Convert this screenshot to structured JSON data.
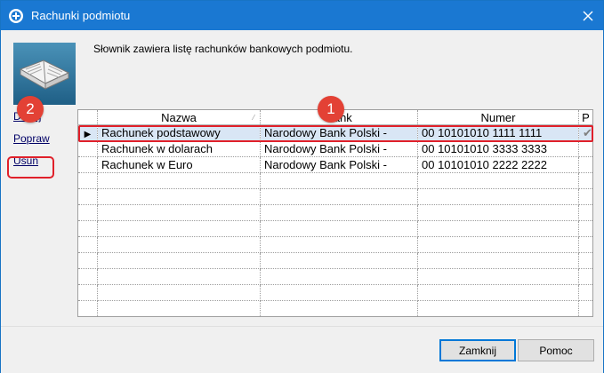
{
  "window": {
    "title": "Rachunki podmiotu",
    "title_bar_color": "#1a78d2"
  },
  "description": "Słownik zawiera listę rachunków bankowych podmiotu.",
  "side_actions": {
    "dodaj": "Dodaj",
    "popraw": "Popraw",
    "usun": "Usuń"
  },
  "grid": {
    "columns": [
      "",
      "Nazwa",
      "Bank",
      "Numer",
      "P"
    ],
    "rows": [
      {
        "indicator": "▶",
        "nazwa": "Rachunek podstawowy",
        "bank": "Narodowy Bank Polski  -",
        "numer": "00 10101010 1111 1111",
        "p": "✔",
        "selected": true
      },
      {
        "indicator": "",
        "nazwa": "Rachunek w dolarach",
        "bank": "Narodowy Bank Polski  -",
        "numer": "00 10101010 3333 3333",
        "p": "",
        "selected": false
      },
      {
        "indicator": "",
        "nazwa": "Rachunek w Euro",
        "bank": "Narodowy Bank Polski  -",
        "numer": "00 10101010 2222 2222",
        "p": "",
        "selected": false
      }
    ],
    "empty_rows": 9
  },
  "annotations": {
    "badge_1": "1",
    "badge_2": "2",
    "highlight_color": "#e0202a"
  },
  "buttons": {
    "close": "Zamknij",
    "help": "Pomoc"
  },
  "icons": {
    "app": "app-logo-icon",
    "book": "book-icon",
    "close": "close-icon"
  }
}
